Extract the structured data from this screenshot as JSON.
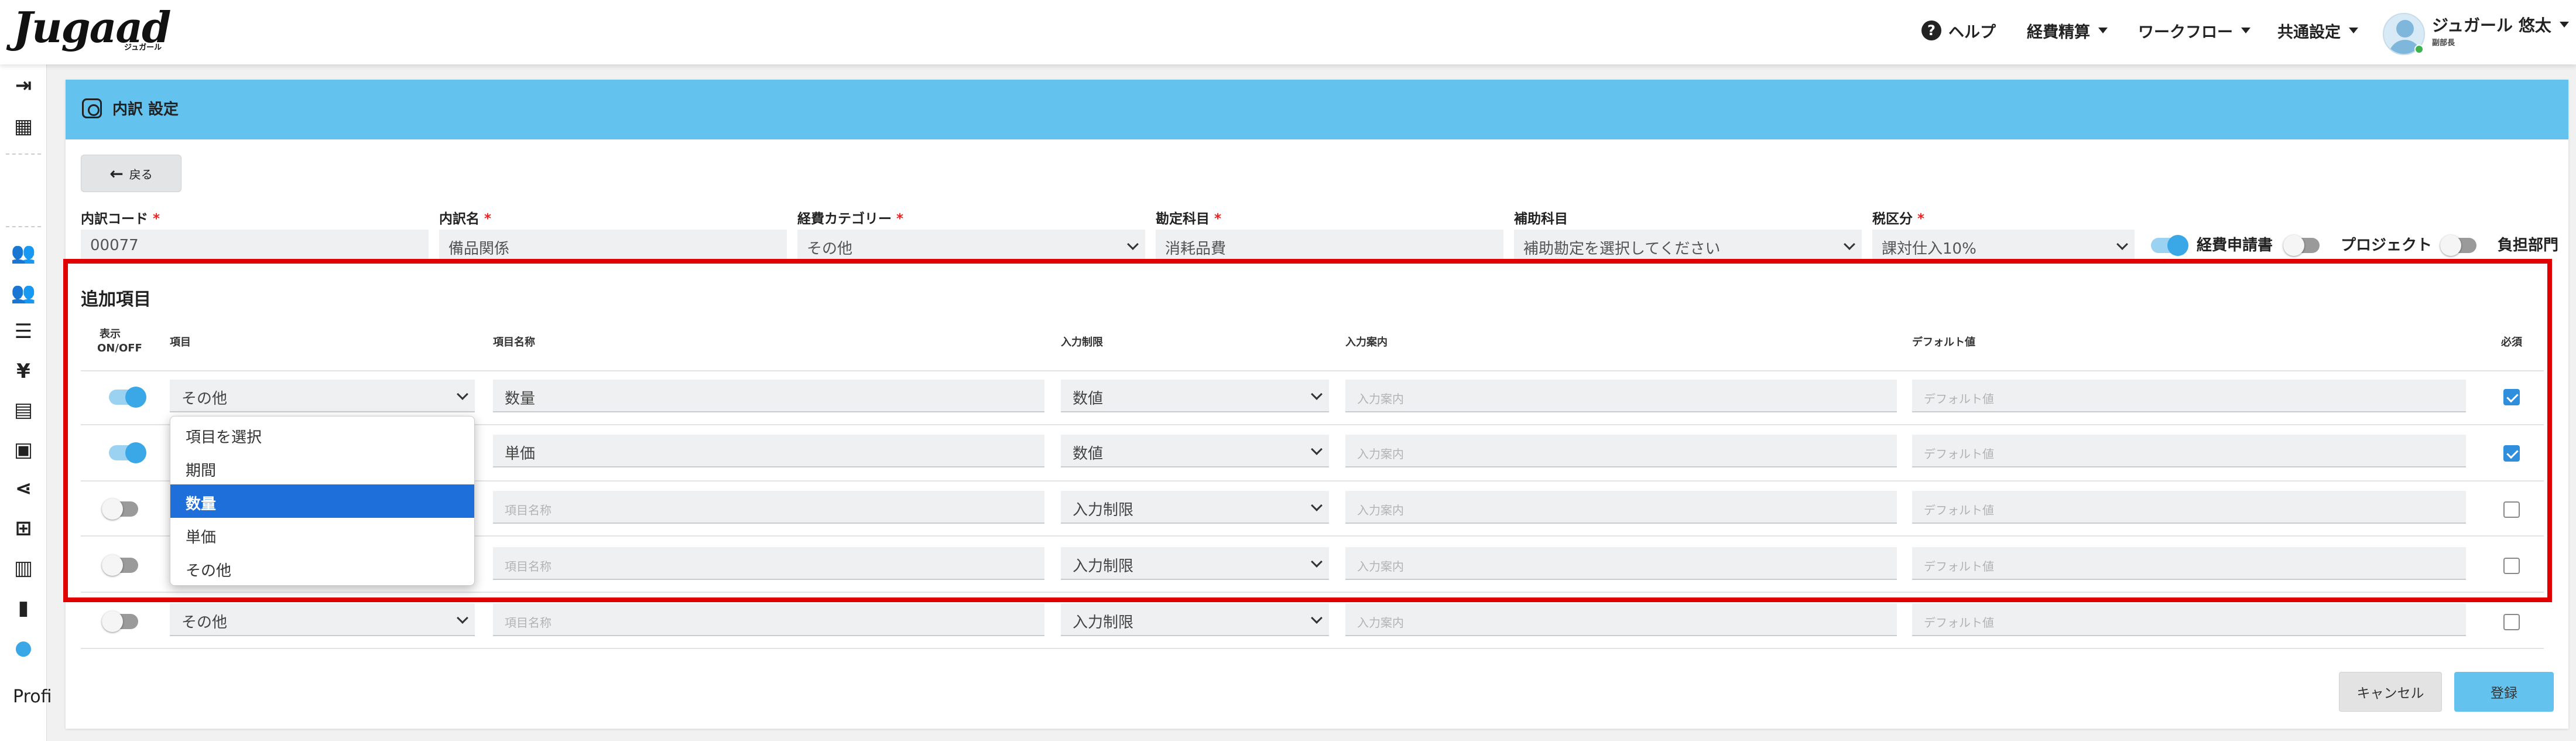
{
  "app": {
    "logo": "Jugaad",
    "logo_sub": "ジュガール"
  },
  "header": {
    "help": "ヘルプ",
    "nav1": "経費精算",
    "nav2": "ワークフロー",
    "nav3": "共通設定",
    "user_name": "ジュガール 悠太",
    "user_role": "副部長"
  },
  "sidebar": {
    "profile_label": "Profi"
  },
  "page": {
    "title": "内訳 設定",
    "back_label": "戻る"
  },
  "form": {
    "code": {
      "label": "内訳コード",
      "value": "00077"
    },
    "name": {
      "label": "内訳名",
      "value": "備品関係"
    },
    "category": {
      "label": "経費カテゴリー",
      "value": "その他"
    },
    "account": {
      "label": "勘定科目",
      "value": "消耗品費"
    },
    "sub_account": {
      "label": "補助科目",
      "value": "補助勘定を選択してください"
    },
    "tax": {
      "label": "税区分",
      "value": "課対仕入10%"
    },
    "toggles": [
      {
        "label": "経費申請書",
        "on": true
      },
      {
        "label": "プロジェクト",
        "on": false
      },
      {
        "label": "負担部門",
        "on": false
      }
    ],
    "required_mark": "*"
  },
  "section": {
    "title": "追加項目",
    "headers": {
      "display_line1": "表示",
      "display_line2": "ON/OFF",
      "item": "項目",
      "item_name": "項目名称",
      "input_limit": "入力制限",
      "input_guide": "入力案内",
      "default_value": "デフォルト値",
      "required": "必須"
    },
    "placeholders": {
      "item_name": "項目名称",
      "input_guide": "入力案内",
      "default_value": "デフォルト値"
    },
    "rows": [
      {
        "on": true,
        "item": "その他",
        "item_name": "数量",
        "limit": "数値",
        "required": true
      },
      {
        "on": true,
        "item": "",
        "item_name": "単価",
        "limit": "数値",
        "required": true
      },
      {
        "on": false,
        "item": "",
        "item_name": "",
        "limit": "入力制限",
        "required": false
      },
      {
        "on": false,
        "item": "",
        "item_name": "",
        "limit": "入力制限",
        "required": false
      },
      {
        "on": false,
        "item": "その他",
        "item_name": "",
        "limit": "入力制限",
        "required": false
      }
    ]
  },
  "dropdown": {
    "options": [
      "項目を選択",
      "期間",
      "数量",
      "単価",
      "その他"
    ],
    "selected": "数量"
  },
  "actions": {
    "cancel": "キャンセル",
    "save": "登録"
  },
  "colors": {
    "header_blue": "#64c2ef",
    "highlight_red": "#e00000",
    "selected_blue": "#1e6fd9"
  }
}
